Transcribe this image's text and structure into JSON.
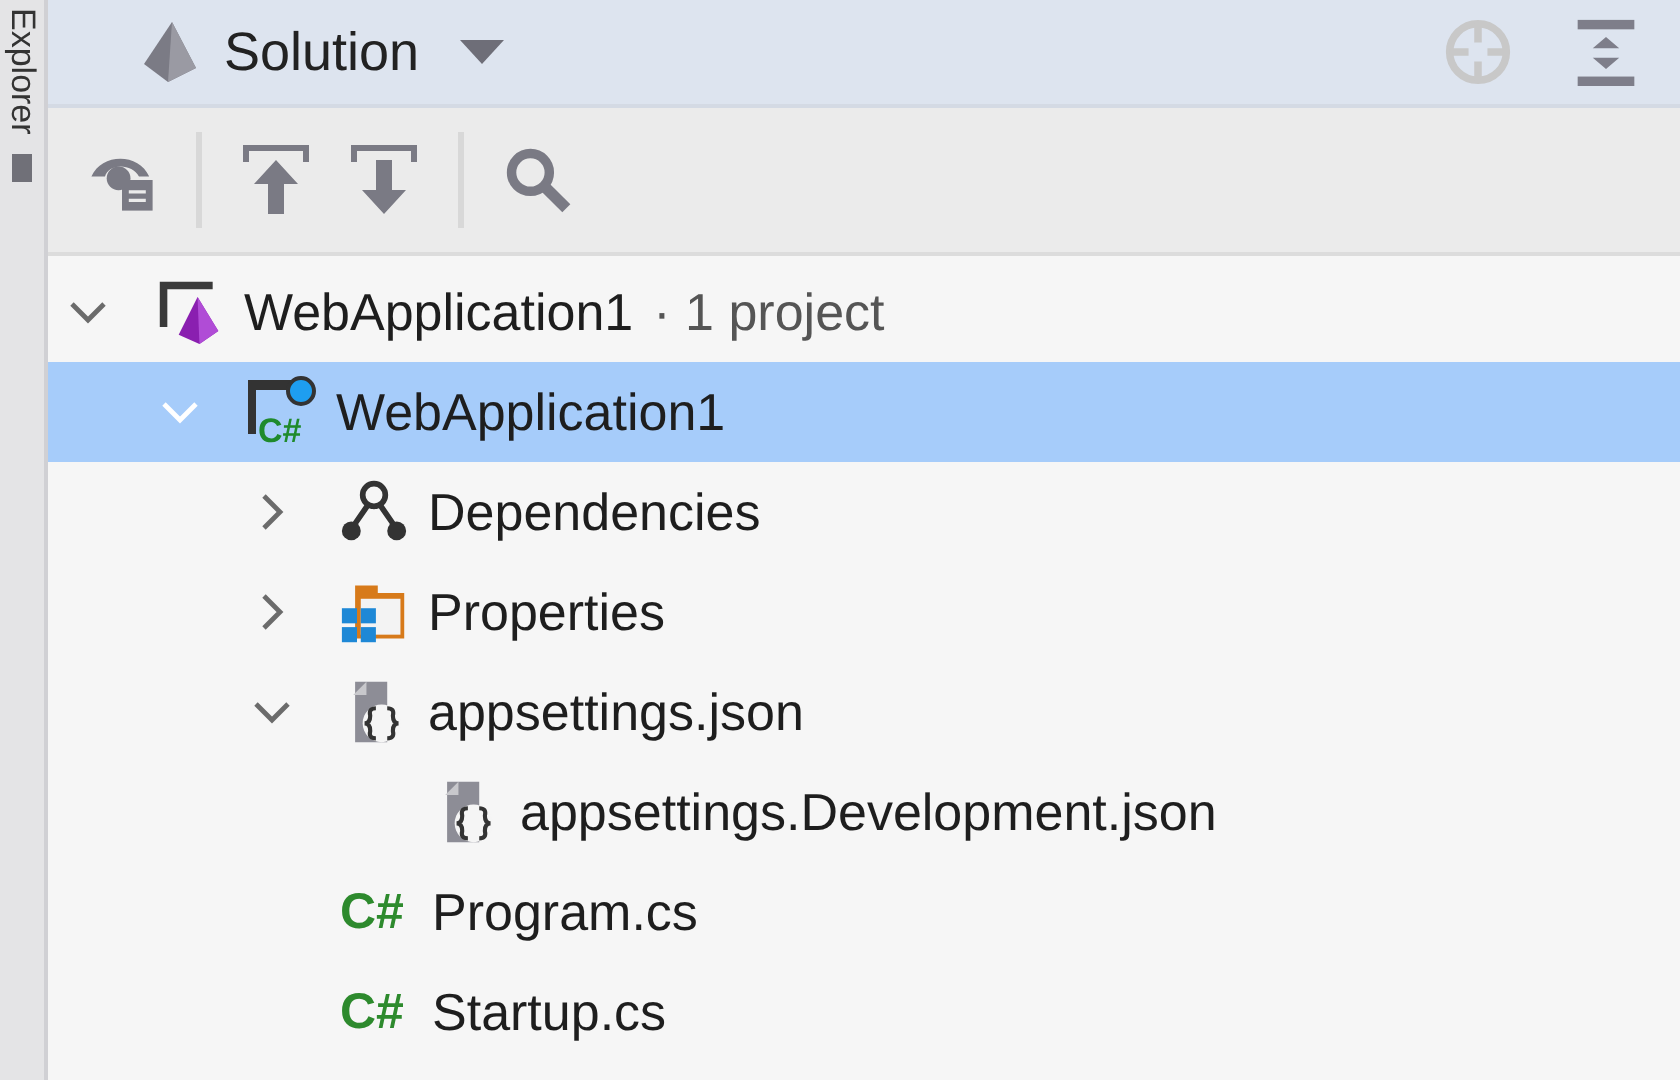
{
  "side_tab": {
    "label": "Explorer"
  },
  "header": {
    "title": "Solution"
  },
  "tree": [
    {
      "label": "WebApplication1",
      "suffix": "· 1 project",
      "kind": "solution",
      "expanded": true,
      "selected": false,
      "children": [
        {
          "label": "WebApplication1",
          "kind": "project",
          "icon_text": "C#",
          "expanded": true,
          "selected": true,
          "children": [
            {
              "label": "Dependencies",
              "kind": "dependencies",
              "expanded": false,
              "selected": false
            },
            {
              "label": "Properties",
              "kind": "properties",
              "expanded": false,
              "selected": false
            },
            {
              "label": "appsettings.json",
              "kind": "json",
              "expanded": true,
              "selected": false,
              "children": [
                {
                  "label": "appsettings.Development.json",
                  "kind": "json",
                  "selected": false
                }
              ]
            },
            {
              "label": "Program.cs",
              "kind": "csharp",
              "icon_text": "C#",
              "selected": false
            },
            {
              "label": "Startup.cs",
              "kind": "csharp",
              "icon_text": "C#",
              "selected": false
            }
          ]
        }
      ]
    }
  ]
}
